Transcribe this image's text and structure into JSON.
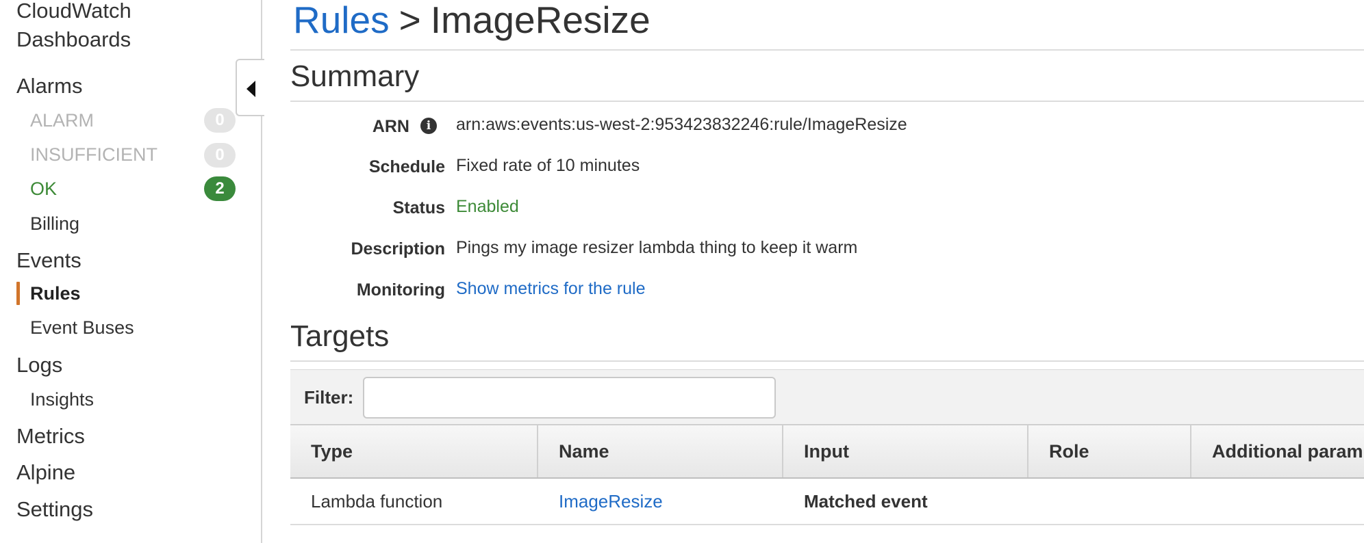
{
  "sidebar": {
    "items": [
      {
        "label": "CloudWatch"
      },
      {
        "label": "Dashboards"
      },
      {
        "label": "Alarms"
      },
      {
        "label": "ALARM",
        "count": "0"
      },
      {
        "label": "INSUFFICIENT",
        "count": "0"
      },
      {
        "label": "OK",
        "count": "2"
      },
      {
        "label": "Billing"
      },
      {
        "label": "Events"
      },
      {
        "label": "Rules"
      },
      {
        "label": "Event Buses"
      },
      {
        "label": "Logs"
      },
      {
        "label": "Insights"
      },
      {
        "label": "Metrics"
      },
      {
        "label": "Alpine"
      },
      {
        "label": "Settings"
      }
    ],
    "active_item": "Rules",
    "active_color": "#d1752b"
  },
  "header": {
    "breadcrumb_link": "Rules",
    "separator": ">",
    "current": "ImageResize"
  },
  "summary": {
    "title": "Summary",
    "arn_label": "ARN",
    "arn_value": "arn:aws:events:us-west-2:953423832246:rule/ImageResize",
    "schedule_label": "Schedule",
    "schedule_value": "Fixed rate of 10 minutes",
    "status_label": "Status",
    "status_value": "Enabled",
    "description_label": "Description",
    "description_value": "Pings my image resizer lambda thing to keep it warm",
    "monitoring_label": "Monitoring",
    "monitoring_link": "Show metrics for the rule"
  },
  "targets": {
    "title": "Targets",
    "filter_label": "Filter:",
    "filter_value": "",
    "columns": [
      "Type",
      "Name",
      "Input",
      "Role",
      "Additional param"
    ],
    "rows": [
      {
        "type": "Lambda function",
        "name": "ImageResize",
        "input": "Matched event",
        "role": "",
        "additional": ""
      }
    ]
  },
  "colors": {
    "link": "#1f6bc6",
    "ok_green": "#3a8a3c",
    "enabled_green": "#3d8a37"
  }
}
